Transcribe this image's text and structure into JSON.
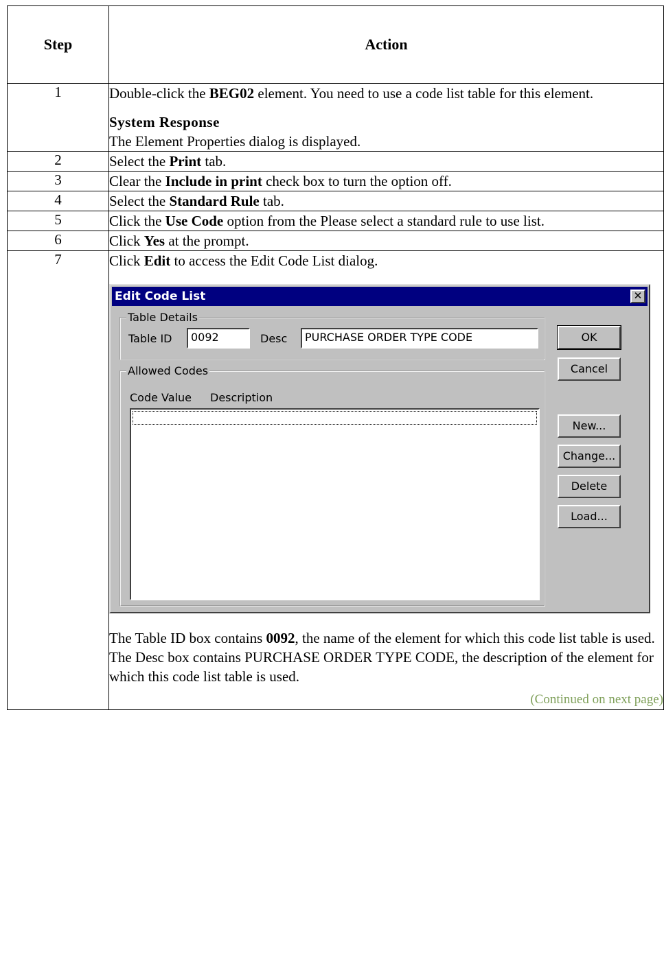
{
  "table": {
    "header_step": "Step",
    "header_action": "Action",
    "continued": "(Continued on next page)"
  },
  "steps": [
    {
      "num": "1",
      "pre": "Double-click the ",
      "bold": "BEG02",
      "post": " element. You need to use a code list table for this element.",
      "sr_heading": "System Response",
      "sr_text": "The Element Properties dialog is displayed."
    },
    {
      "num": "2",
      "pre": "Select the ",
      "bold": "Print",
      "post": " tab."
    },
    {
      "num": "3",
      "pre": "Clear the ",
      "bold": "Include in print",
      "post": " check box to turn the option off."
    },
    {
      "num": "4",
      "pre": "Select the ",
      "bold": "Standard Rule",
      "post": " tab."
    },
    {
      "num": "5",
      "pre": "Click the ",
      "bold": "Use Code",
      "post": " option from the Please select a standard rule to use list."
    },
    {
      "num": "6",
      "pre": "Click ",
      "bold": "Yes",
      "post": " at the prompt."
    },
    {
      "num": "7",
      "pre": "Click ",
      "bold": "Edit",
      "post": " to access the Edit Code List dialog.",
      "note_pre": "The Table ID box contains ",
      "note_bold": "0092",
      "note_post": ", the name of the element for which this code list table is used. The Desc box contains PURCHASE ORDER TYPE CODE, the description of the element for which this code list table is used."
    }
  ],
  "dialog": {
    "title": "Edit Code List",
    "table_details_label": "Table Details",
    "table_id_label": "Table ID",
    "table_id_value": "0092",
    "desc_label": "Desc",
    "desc_value": "PURCHASE ORDER TYPE CODE",
    "allowed_codes_label": "Allowed Codes",
    "col_code_value": "Code Value",
    "col_description": "Description",
    "buttons": {
      "ok": "OK",
      "cancel": "Cancel",
      "new": "New...",
      "change": "Change...",
      "delete": "Delete",
      "load": "Load..."
    }
  }
}
